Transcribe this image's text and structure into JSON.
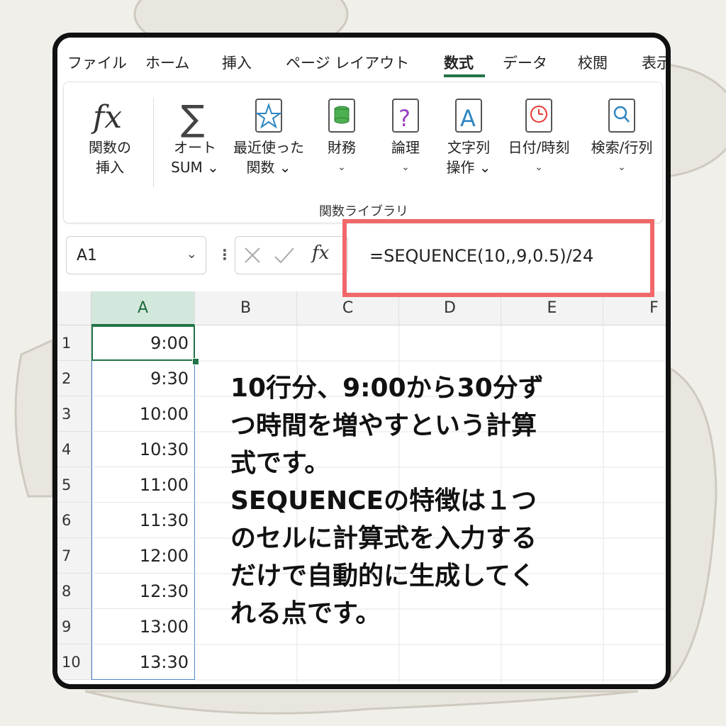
{
  "tabs": [
    {
      "label": "ファイル",
      "active": false
    },
    {
      "label": "ホーム",
      "active": false
    },
    {
      "label": "挿入",
      "active": false
    },
    {
      "label": "ページ レイアウト",
      "active": false
    },
    {
      "label": "数式",
      "active": true
    },
    {
      "label": "データ",
      "active": false
    },
    {
      "label": "校閲",
      "active": false
    },
    {
      "label": "表示",
      "active": false
    }
  ],
  "ribbon": {
    "insert_function": {
      "line1": "関数の",
      "line2": "挿入"
    },
    "autosum": {
      "line1": "オート",
      "line2": "SUM ⌄"
    },
    "recent": {
      "line1": "最近使った",
      "line2": "関数 ⌄"
    },
    "financial": {
      "line1": "財務",
      "line2": "⌄"
    },
    "logical": {
      "line1": "論理",
      "line2": "⌄"
    },
    "text": {
      "line1": "文字列",
      "line2": "操作 ⌄"
    },
    "datetime": {
      "line1": "日付/時刻",
      "line2": "⌄"
    },
    "lookup": {
      "line1": "検索/行列",
      "line2": "⌄"
    },
    "group_label": "関数ライブラリ",
    "icons": [
      "fx-icon",
      "sigma-icon",
      "star-book-icon",
      "coins-book-icon",
      "question-book-icon",
      "letter-a-book-icon",
      "clock-book-icon",
      "magnifier-book-icon"
    ]
  },
  "formula_bar": {
    "name_box": "A1",
    "formula": "=SEQUENCE(10,,9,0.5)/24"
  },
  "grid": {
    "columns": [
      "A",
      "B",
      "C",
      "D",
      "E",
      "F"
    ],
    "rows": [
      "1",
      "2",
      "3",
      "4",
      "5",
      "6",
      "7",
      "8",
      "9",
      "10"
    ],
    "values": [
      "9:00",
      "9:30",
      "10:00",
      "10:30",
      "11:00",
      "11:30",
      "12:00",
      "12:30",
      "13:00",
      "13:30"
    ]
  },
  "overlay_text": [
    "10行分、9:00から30分ず",
    "つ時間を増やすという計算",
    "式です。",
    "SEQUENCEの特徴は１つ",
    "のセルに計算式を入力する",
    "だけで自動的に生成してく",
    "れる点です。"
  ],
  "colors": {
    "accent": "#217346",
    "highlight_box": "#f0686a",
    "selection_border": "#4a86c8"
  }
}
